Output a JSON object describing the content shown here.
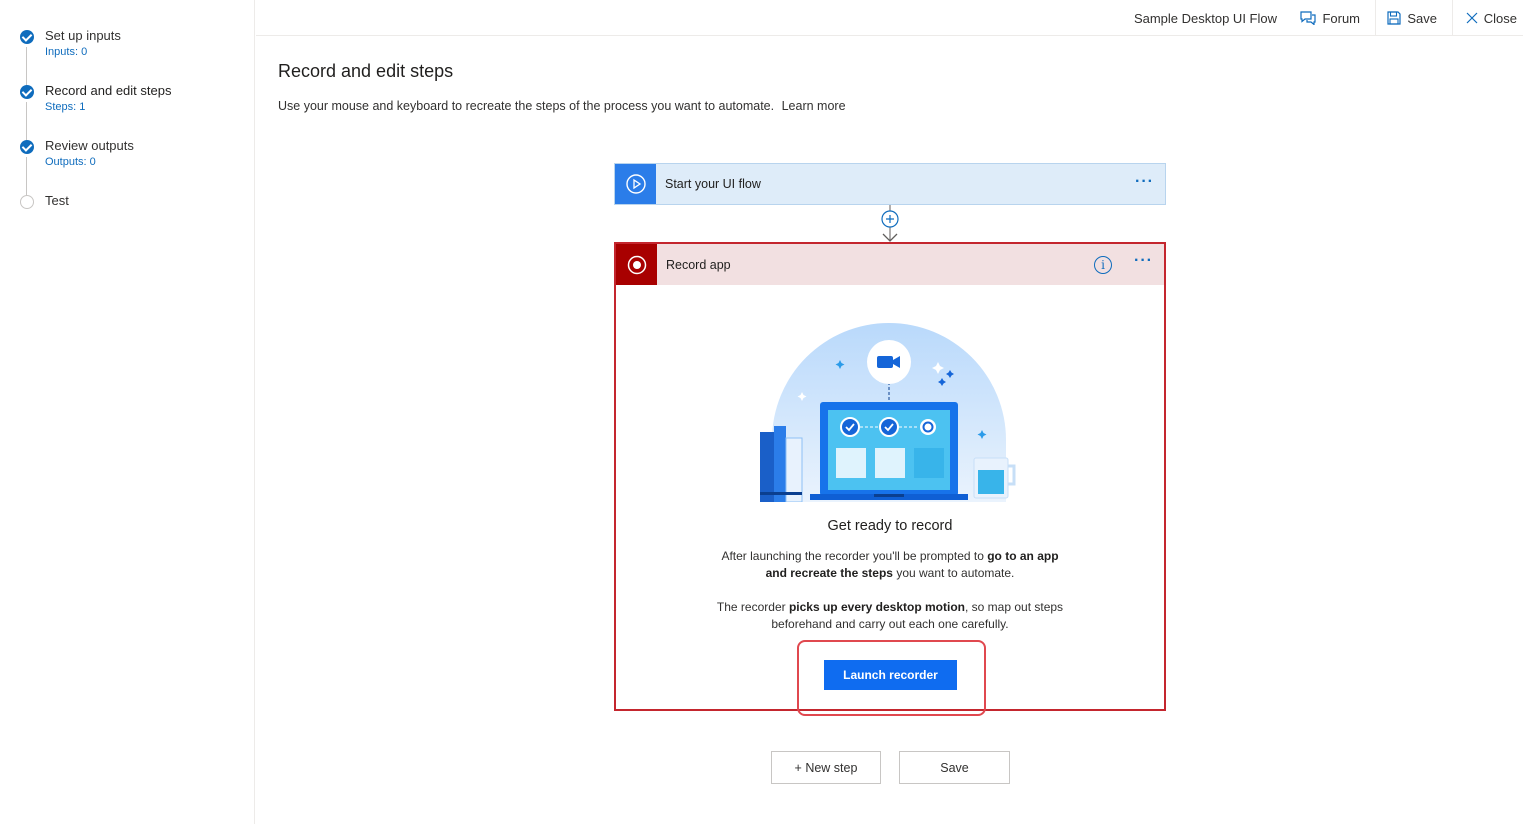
{
  "sidebar": {
    "steps": [
      {
        "title": "Set up inputs",
        "sub": "Inputs: 0",
        "status": "done"
      },
      {
        "title": "Record and edit steps",
        "sub": "Steps: 1",
        "status": "done"
      },
      {
        "title": "Review outputs",
        "sub": "Outputs: 0",
        "status": "done"
      },
      {
        "title": "Test",
        "sub": "",
        "status": "todo"
      }
    ]
  },
  "topbar": {
    "app_title": "Sample Desktop UI Flow",
    "forum_label": "Forum",
    "save_label": "Save",
    "close_label": "Close"
  },
  "main": {
    "title": "Record and edit steps",
    "description": "Use your mouse and keyboard to recreate the steps of the process you want to automate.",
    "learn_more": "Learn more"
  },
  "trigger_card": {
    "label": "Start your UI flow",
    "more": "···"
  },
  "record_card": {
    "label": "Record app",
    "info": "i",
    "more": "···",
    "ready_title": "Get ready to record",
    "para1_pre": "After launching the recorder you'll be prompted to ",
    "para1_bold": "go to an app and recreate the steps",
    "para1_post": " you want to automate.",
    "para2_pre": "The recorder ",
    "para2_bold": "picks up every desktop motion",
    "para2_post": ", so map out steps beforehand and carry out each one carefully.",
    "launch_label": "Launch recorder"
  },
  "bottom": {
    "new_step_label": "+ New step",
    "save_label": "Save"
  },
  "colors": {
    "accent": "#0f6cbd",
    "trigger_icon_bg": "#2b7de9",
    "record_icon_bg": "#a80000",
    "record_border": "#c4262e",
    "launch_button": "#0f6cf0"
  }
}
